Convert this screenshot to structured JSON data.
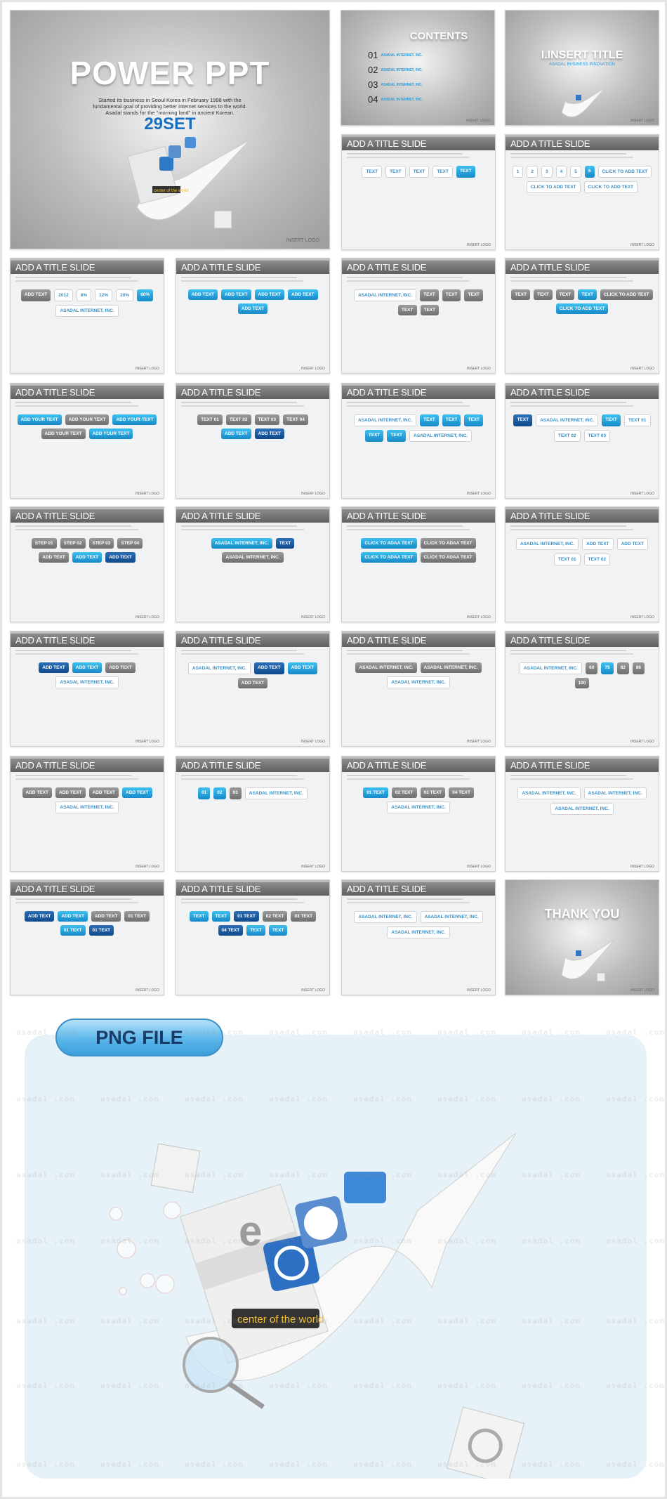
{
  "watermark": "asadal .com",
  "insert_logo": "INSERT LOGO",
  "cover": {
    "title": "POWER PPT",
    "subtitle_lines": [
      "Started its business in Seoul Korea in February 1998 with the",
      "fundamental goal of providing better internet services to the world.",
      "Asadal stands for the \"morning land\" in ancient Korean."
    ],
    "set_count": "29SET",
    "badge": "center of the world"
  },
  "contents_slide": {
    "title": "CONTENTS",
    "items": [
      {
        "num": "01",
        "label": "ASADAL INTERNET, INC."
      },
      {
        "num": "02",
        "label": "ASADAL INTERNET, INC."
      },
      {
        "num": "03",
        "label": "ASADAL INTERNET, INC."
      },
      {
        "num": "04",
        "label": "ASADAL INTERNET, INC."
      }
    ]
  },
  "section_slide": {
    "title": "I.INSERT TITLE",
    "subtitle": "ASADAL BUSINESS INNOVATION"
  },
  "thankyou_slide": {
    "title": "THANK YOU"
  },
  "slide_title": "ADD A TITLE SLIDE",
  "slides": [
    {
      "labels": [
        [
          "TEXT",
          "plain"
        ],
        [
          "TEXT",
          "plain"
        ],
        [
          "TEXT",
          "plain"
        ],
        [
          "TEXT",
          "plain"
        ],
        [
          "TEXT",
          "blue"
        ]
      ]
    },
    {
      "labels": [
        [
          "1",
          "plain"
        ],
        [
          "2",
          "plain"
        ],
        [
          "3",
          "plain"
        ],
        [
          "4",
          "plain"
        ],
        [
          "5",
          "plain"
        ],
        [
          "6",
          "blue"
        ],
        [
          "CLICK TO ADD TEXT",
          "plain"
        ],
        [
          "CLICK TO ADD TEXT",
          "plain"
        ],
        [
          "CLICK TO ADD TEXT",
          "plain"
        ]
      ]
    },
    {
      "labels": [
        [
          "ADD TEXT",
          ""
        ],
        [
          "2012",
          "plain"
        ],
        [
          "8%",
          "plain"
        ],
        [
          "12%",
          "plain"
        ],
        [
          "20%",
          "plain"
        ],
        [
          "60%",
          "blue"
        ],
        [
          "ASADAL INTERNET, INC.",
          "plain"
        ]
      ]
    },
    {
      "labels": [
        [
          "ADD TEXT",
          "blue"
        ],
        [
          "ADD TEXT",
          "blue"
        ],
        [
          "ADD TEXT",
          "blue"
        ],
        [
          "ADD TEXT",
          "blue"
        ],
        [
          "ADD TEXT",
          "blue"
        ]
      ]
    },
    {
      "labels": [
        [
          "ASADAL INTERNET, INC.",
          "plain"
        ],
        [
          "TEXT",
          ""
        ],
        [
          "TEXT",
          ""
        ],
        [
          "TEXT",
          ""
        ],
        [
          "TEXT",
          ""
        ],
        [
          "TEXT",
          ""
        ]
      ]
    },
    {
      "labels": [
        [
          "TEXT",
          ""
        ],
        [
          "TEXT",
          ""
        ],
        [
          "TEXT",
          ""
        ],
        [
          "TEXT",
          "blue"
        ],
        [
          "CLICK TO ADD TEXT",
          ""
        ],
        [
          "CLICK TO ADD TEXT",
          "blue"
        ]
      ]
    },
    {
      "labels": [
        [
          "ADD YOUR TEXT",
          "blue"
        ],
        [
          "ADD YOUR TEXT",
          ""
        ],
        [
          "ADD YOUR TEXT",
          "blue"
        ],
        [
          "ADD YOUR TEXT",
          ""
        ],
        [
          "ADD YOUR TEXT",
          "blue"
        ]
      ]
    },
    {
      "labels": [
        [
          "TEXT 01",
          ""
        ],
        [
          "TEXT 02",
          ""
        ],
        [
          "TEXT 03",
          ""
        ],
        [
          "TEXT 04",
          ""
        ],
        [
          "ADD TEXT",
          "blue"
        ],
        [
          "ADD TEXT",
          "dark"
        ]
      ]
    },
    {
      "labels": [
        [
          "ASADAL INTERNET, INC.",
          "plain"
        ],
        [
          "TEXT",
          "blue"
        ],
        [
          "TEXT",
          "blue"
        ],
        [
          "TEXT",
          "blue"
        ],
        [
          "TEXT",
          "blue"
        ],
        [
          "TEXT",
          "blue"
        ],
        [
          "ASADAL INTERNET, INC.",
          "plain"
        ]
      ]
    },
    {
      "labels": [
        [
          "TEXT",
          "dark"
        ],
        [
          "ASADAL INTERNET, INC.",
          "plain"
        ],
        [
          "TEXT",
          "blue"
        ],
        [
          "TEXT 01",
          "plain"
        ],
        [
          "TEXT 02",
          "plain"
        ],
        [
          "TEXT 03",
          "plain"
        ]
      ]
    },
    {
      "labels": [
        [
          "STEP 01",
          ""
        ],
        [
          "STEP 02",
          ""
        ],
        [
          "STEP 03",
          ""
        ],
        [
          "STEP 04",
          ""
        ],
        [
          "ADD TEXT",
          ""
        ],
        [
          "ADD TEXT",
          "blue"
        ],
        [
          "ADD TEXT",
          "dark"
        ]
      ]
    },
    {
      "labels": [
        [
          "ASADAL INTERNET, INC.",
          "blue"
        ],
        [
          "TEXT",
          "dark"
        ],
        [
          "ASADAL INTERNET, INC.",
          ""
        ]
      ]
    },
    {
      "labels": [
        [
          "CLICK TO ADAA TEXT",
          "blue"
        ],
        [
          "CLICK TO ADAA TEXT",
          ""
        ],
        [
          "CLICK TO ADAA TEXT",
          "blue"
        ],
        [
          "CLICK TO ADAA TEXT",
          ""
        ]
      ]
    },
    {
      "labels": [
        [
          "ASADAL INTERNET, INC.",
          "plain"
        ],
        [
          "ADD TEXT",
          "plain"
        ],
        [
          "ADD TEXT",
          "plain"
        ],
        [
          "TEXT 01",
          "plain"
        ],
        [
          "TEXT 02",
          "plain"
        ]
      ]
    },
    {
      "labels": [
        [
          "ADD TEXT",
          "dark"
        ],
        [
          "ADD TEXT",
          "blue"
        ],
        [
          "ADD TEXT",
          ""
        ],
        [
          "ASADAL INTERNET, INC.",
          "plain"
        ]
      ]
    },
    {
      "labels": [
        [
          "ASADAL INTERNET, INC.",
          "plain"
        ],
        [
          "ADD TEXT",
          "dark"
        ],
        [
          "ADD TEXT",
          "blue"
        ],
        [
          "ADD TEXT",
          ""
        ]
      ]
    },
    {
      "labels": [
        [
          "ASADAL INTERNET, INC.",
          ""
        ],
        [
          "ASADAL INTERNET, INC.",
          ""
        ],
        [
          "ASADAL INTERNET, INC.",
          "plain"
        ]
      ]
    },
    {
      "labels": [
        [
          "ASADAL INTERNET, INC.",
          "plain"
        ],
        [
          "60",
          ""
        ],
        [
          "75",
          "blue"
        ],
        [
          "82",
          ""
        ],
        [
          "86",
          ""
        ],
        [
          "100",
          ""
        ]
      ]
    },
    {
      "labels": [
        [
          "ADD TEXT",
          ""
        ],
        [
          "ADD TEXT",
          ""
        ],
        [
          "ADD TEXT",
          ""
        ],
        [
          "ADD TEXT",
          "blue"
        ],
        [
          "ASADAL INTERNET, INC.",
          "plain"
        ]
      ]
    },
    {
      "labels": [
        [
          "01",
          "blue"
        ],
        [
          "02",
          "blue"
        ],
        [
          "03",
          ""
        ],
        [
          "ASADAL INTERNET, INC.",
          "plain"
        ]
      ]
    },
    {
      "labels": [
        [
          "01 TEXT",
          "blue"
        ],
        [
          "02 TEXT",
          ""
        ],
        [
          "03 TEXT",
          ""
        ],
        [
          "04 TEXT",
          ""
        ],
        [
          "ASADAL INTERNET, INC.",
          "plain"
        ]
      ]
    },
    {
      "labels": [
        [
          "ASADAL INTERNET, INC.",
          "plain"
        ],
        [
          "ASADAL INTERNET, INC.",
          "plain"
        ],
        [
          "ASADAL INTERNET, INC.",
          "plain"
        ]
      ]
    },
    {
      "labels": [
        [
          "ADD TEXT",
          "dark"
        ],
        [
          "ADD TEXT",
          "blue"
        ],
        [
          "ADD TEXT",
          ""
        ],
        [
          "01 TEXT",
          ""
        ],
        [
          "01 TEXT",
          "blue"
        ],
        [
          "01 TEXT",
          "dark"
        ]
      ]
    },
    {
      "labels": [
        [
          "TEXT",
          "blue"
        ],
        [
          "TEXT",
          "blue"
        ],
        [
          "01 TEXT",
          "dark"
        ],
        [
          "02 TEXT",
          ""
        ],
        [
          "03 TEXT",
          ""
        ],
        [
          "04 TEXT",
          "dark"
        ],
        [
          "TEXT",
          "blue"
        ],
        [
          "TEXT",
          "blue"
        ]
      ]
    },
    {
      "labels": [
        [
          "ASADAL INTERNET, INC.",
          "plain"
        ],
        [
          "ASADAL INTERNET, INC.",
          "plain"
        ],
        [
          "ASADAL INTERNET, INC.",
          "plain"
        ]
      ]
    }
  ],
  "png_section": {
    "label": "PNG FILE",
    "badge": "center of the world"
  },
  "colors": {
    "accent_blue": "#1a8fd6",
    "title_blue": "#1a6fbf",
    "panel": "#e6f2f8"
  }
}
